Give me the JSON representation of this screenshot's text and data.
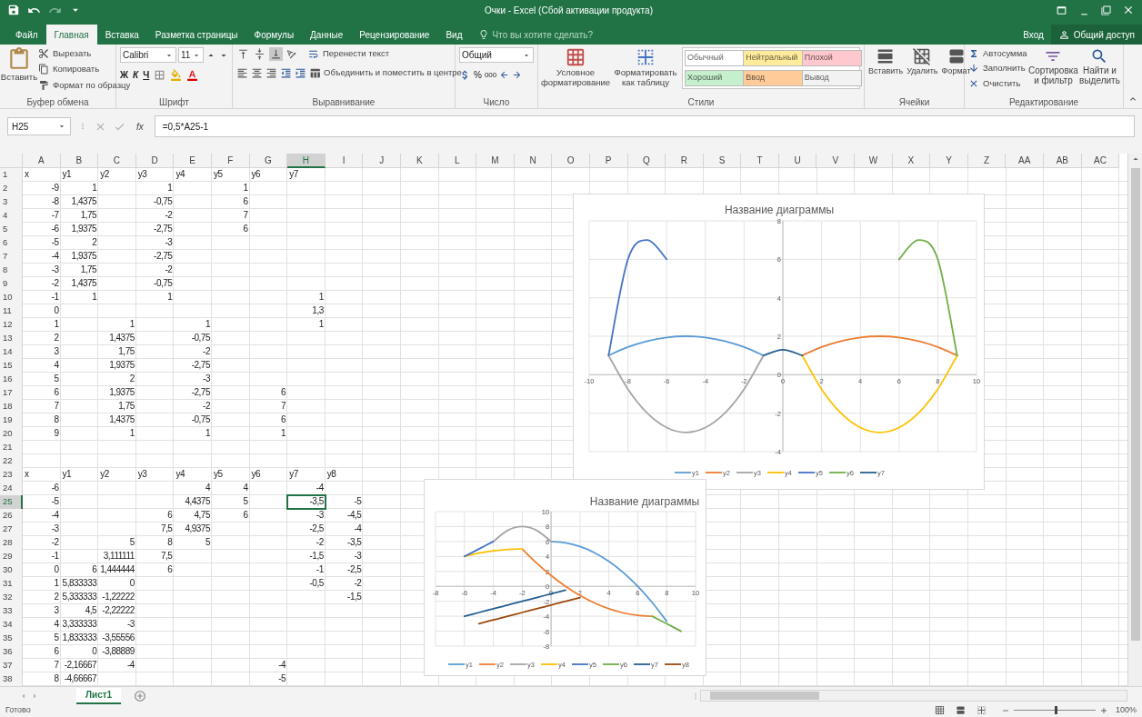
{
  "window": {
    "title": "Очки - Excel (Сбой активации продукта)"
  },
  "tabs": [
    {
      "label": "Файл",
      "selected": false
    },
    {
      "label": "Главная",
      "selected": true
    },
    {
      "label": "Вставка",
      "selected": false
    },
    {
      "label": "Разметка страницы",
      "selected": false
    },
    {
      "label": "Формулы",
      "selected": false
    },
    {
      "label": "Данные",
      "selected": false
    },
    {
      "label": "Рецензирование",
      "selected": false
    },
    {
      "label": "Вид",
      "selected": false
    }
  ],
  "tell_me": {
    "placeholder": "Что вы хотите сделать?"
  },
  "sign_in": "Вход",
  "share": "Общий доступ",
  "ribbon": {
    "clipboard": {
      "paste": "Вставить",
      "cut": "Вырезать",
      "copy": "Копировать",
      "format_painter": "Формат по образцу",
      "label": "Буфер обмена"
    },
    "font": {
      "family": "Calibri",
      "size": "11",
      "bold": "Ж",
      "italic": "К",
      "underline": "Ч",
      "label": "Шрифт"
    },
    "alignment": {
      "vertical_align": [
        {
          "selected": false
        },
        {
          "selected": false
        },
        {
          "selected": true
        }
      ],
      "wrap": "Перенести текст",
      "merge": "Объединить и поместить в центре",
      "label": "Выравнивание"
    },
    "number": {
      "format": "Общий",
      "percent": "%",
      "thousands": "000",
      "label": "Число"
    },
    "styles": {
      "conditional": "Условное форматирование",
      "format_table": "Форматировать как таблицу",
      "cell_styles": [
        {
          "label": "Обычный",
          "color": "#ffffff"
        },
        {
          "label": "Нейтральный",
          "color": "#ffeb9c"
        },
        {
          "label": "Плохой",
          "color": "#ffc7ce"
        },
        {
          "label": "Хороший",
          "color": "#c6efce"
        },
        {
          "label": "Ввод",
          "color": "#ffcc99"
        },
        {
          "label": "Вывод",
          "color": "#f2f2f2"
        }
      ],
      "label": "Стили"
    },
    "cells": {
      "buttons": [
        "Вставить",
        "Удалить",
        "Формат"
      ],
      "label": "Ячейки"
    },
    "editing": {
      "autosum": "Автосумма",
      "fill": "Заполнить",
      "clear": "Очистить",
      "sort": "Сортировка и фильтр",
      "find": "Найти и выделить",
      "label": "Редактирование"
    }
  },
  "formula_bar": {
    "name_box": "H25",
    "fx": "fx",
    "formula": "=0,5*A25-1"
  },
  "sheet": {
    "columns": [
      {
        "label": "A",
        "selected": false
      },
      {
        "label": "B",
        "selected": false
      },
      {
        "label": "C",
        "selected": false
      },
      {
        "label": "D",
        "selected": false
      },
      {
        "label": "E",
        "selected": false
      },
      {
        "label": "F",
        "selected": false
      },
      {
        "label": "G",
        "selected": false
      },
      {
        "label": "H",
        "selected": true
      },
      {
        "label": "I",
        "selected": false
      },
      {
        "label": "J",
        "selected": false
      },
      {
        "label": "K",
        "selected": false
      },
      {
        "label": "L",
        "selected": false
      },
      {
        "label": "M",
        "selected": false
      },
      {
        "label": "N",
        "selected": false
      },
      {
        "label": "O",
        "selected": false
      },
      {
        "label": "P",
        "selected": false
      },
      {
        "label": "Q",
        "selected": false
      },
      {
        "label": "R",
        "selected": false
      },
      {
        "label": "S",
        "selected": false
      },
      {
        "label": "T",
        "selected": false
      },
      {
        "label": "U",
        "selected": false
      },
      {
        "label": "V",
        "selected": false
      },
      {
        "label": "W",
        "selected": false
      },
      {
        "label": "X",
        "selected": false
      },
      {
        "label": "Y",
        "selected": false
      },
      {
        "label": "Z",
        "selected": false
      },
      {
        "label": "AA",
        "selected": false
      },
      {
        "label": "AB",
        "selected": false
      },
      {
        "label": "AC",
        "selected": false
      }
    ],
    "rows": [
      {
        "number": "1",
        "kind": "header",
        "selected": false,
        "cells": [
          "x",
          "y1",
          "y2",
          "y3",
          "y4",
          "y5",
          "y6",
          "y7"
        ]
      },
      {
        "number": "2",
        "kind": "data",
        "selected": false,
        "cells": [
          "-9",
          "1",
          null,
          "1",
          null,
          "1"
        ]
      },
      {
        "number": "3",
        "kind": "data",
        "selected": false,
        "cells": [
          "-8",
          "1,4375",
          null,
          "-0,75",
          null,
          "6"
        ]
      },
      {
        "number": "4",
        "kind": "data",
        "selected": false,
        "cells": [
          "-7",
          "1,75",
          null,
          "-2",
          null,
          "7"
        ]
      },
      {
        "number": "5",
        "kind": "data",
        "selected": false,
        "cells": [
          "-6",
          "1,9375",
          null,
          "-2,75",
          null,
          "6"
        ]
      },
      {
        "number": "6",
        "kind": "data",
        "selected": false,
        "cells": [
          "-5",
          "2",
          null,
          "-3"
        ]
      },
      {
        "number": "7",
        "kind": "data",
        "selected": false,
        "cells": [
          "-4",
          "1,9375",
          null,
          "-2,75"
        ]
      },
      {
        "number": "8",
        "kind": "data",
        "selected": false,
        "cells": [
          "-3",
          "1,75",
          null,
          "-2"
        ]
      },
      {
        "number": "9",
        "kind": "data",
        "selected": false,
        "cells": [
          "-2",
          "1,4375",
          null,
          "-0,75"
        ]
      },
      {
        "number": "10",
        "kind": "data",
        "selected": false,
        "cells": [
          "-1",
          "1",
          null,
          "1",
          null,
          null,
          null,
          "1"
        ]
      },
      {
        "number": "11",
        "kind": "data",
        "selected": false,
        "cells": [
          "0",
          null,
          null,
          null,
          null,
          null,
          null,
          "1,3"
        ]
      },
      {
        "number": "12",
        "kind": "data",
        "selected": false,
        "cells": [
          "1",
          null,
          "1",
          null,
          "1",
          null,
          null,
          "1"
        ]
      },
      {
        "number": "13",
        "kind": "data",
        "selected": false,
        "cells": [
          "2",
          null,
          "1,4375",
          null,
          "-0,75"
        ]
      },
      {
        "number": "14",
        "kind": "data",
        "selected": false,
        "cells": [
          "3",
          null,
          "1,75",
          null,
          "-2"
        ]
      },
      {
        "number": "15",
        "kind": "data",
        "selected": false,
        "cells": [
          "4",
          null,
          "1,9375",
          null,
          "-2,75"
        ]
      },
      {
        "number": "16",
        "kind": "data",
        "selected": false,
        "cells": [
          "5",
          null,
          "2",
          null,
          "-3"
        ]
      },
      {
        "number": "17",
        "kind": "data",
        "selected": false,
        "cells": [
          "6",
          null,
          "1,9375",
          null,
          "-2,75",
          null,
          "6"
        ]
      },
      {
        "number": "18",
        "kind": "data",
        "selected": false,
        "cells": [
          "7",
          null,
          "1,75",
          null,
          "-2",
          null,
          "7"
        ]
      },
      {
        "number": "19",
        "kind": "data",
        "selected": false,
        "cells": [
          "8",
          null,
          "1,4375",
          null,
          "-0,75",
          null,
          "6"
        ]
      },
      {
        "number": "20",
        "kind": "data",
        "selected": false,
        "cells": [
          "9",
          null,
          "1",
          null,
          "1",
          null,
          "1"
        ]
      },
      {
        "number": "21",
        "kind": "data",
        "selected": false,
        "cells": []
      },
      {
        "number": "22",
        "kind": "data",
        "selected": false,
        "cells": []
      },
      {
        "number": "23",
        "kind": "header",
        "selected": false,
        "cells": [
          "x",
          "y1",
          "y2",
          "y3",
          "y4",
          "y5",
          "y6",
          "y7",
          "y8"
        ]
      },
      {
        "number": "24",
        "kind": "data",
        "selected": false,
        "cells": [
          "-6",
          null,
          null,
          null,
          "4",
          "4",
          null,
          "-4"
        ]
      },
      {
        "number": "25",
        "kind": "data",
        "selected": true,
        "cells": [
          "-5",
          null,
          null,
          null,
          "4,4375",
          "5",
          null,
          "-3,5",
          "-5"
        ]
      },
      {
        "number": "26",
        "kind": "data",
        "selected": false,
        "cells": [
          "-4",
          null,
          null,
          "6",
          "4,75",
          "6",
          null,
          "-3",
          "-4,5"
        ]
      },
      {
        "number": "27",
        "kind": "data",
        "selected": false,
        "cells": [
          "-3",
          null,
          null,
          "7,5",
          "4,9375",
          null,
          null,
          "-2,5",
          "-4"
        ]
      },
      {
        "number": "28",
        "kind": "data",
        "selected": false,
        "cells": [
          "-2",
          null,
          "5",
          "8",
          "5",
          null,
          null,
          "-2",
          "-3,5"
        ]
      },
      {
        "number": "29",
        "kind": "data",
        "selected": false,
        "cells": [
          "-1",
          null,
          "3,111111",
          "7,5",
          null,
          null,
          null,
          "-1,5",
          "-3"
        ]
      },
      {
        "number": "30",
        "kind": "data",
        "selected": false,
        "cells": [
          "0",
          "6",
          "1,444444",
          "6",
          null,
          null,
          null,
          "-1",
          "-2,5"
        ]
      },
      {
        "number": "31",
        "kind": "data",
        "selected": false,
        "cells": [
          "1",
          "5,833333",
          "0",
          null,
          null,
          null,
          null,
          "-0,5",
          "-2"
        ]
      },
      {
        "number": "32",
        "kind": "data",
        "selected": false,
        "cells": [
          "2",
          "5,333333",
          "-1,22222",
          null,
          null,
          null,
          null,
          null,
          "-1,5"
        ]
      },
      {
        "number": "33",
        "kind": "data",
        "selected": false,
        "cells": [
          "3",
          "4,5",
          "-2,22222"
        ]
      },
      {
        "number": "34",
        "kind": "data",
        "selected": false,
        "cells": [
          "4",
          "3,333333",
          "-3"
        ]
      },
      {
        "number": "35",
        "kind": "data",
        "selected": false,
        "cells": [
          "5",
          "1,833333",
          "-3,55556"
        ]
      },
      {
        "number": "36",
        "kind": "data",
        "selected": false,
        "cells": [
          "6",
          "0",
          "-3,88889"
        ]
      },
      {
        "number": "37",
        "kind": "data",
        "selected": false,
        "cells": [
          "7",
          "-2,16667",
          "-4",
          null,
          null,
          null,
          "-4"
        ]
      },
      {
        "number": "38",
        "kind": "data",
        "selected": false,
        "cells": [
          "8",
          "-4,66667",
          null,
          null,
          null,
          null,
          "-5"
        ]
      }
    ]
  },
  "charts": [
    {
      "chart_data": {
        "type": "line",
        "title": "Название диаграммы",
        "grid": true,
        "legend": "bottom",
        "x": [
          -9,
          -8,
          -7,
          -6,
          -5,
          -4,
          -3,
          -2,
          -1,
          0,
          1,
          2,
          3,
          4,
          5,
          6,
          7,
          8,
          9
        ],
        "xlim": [
          -10,
          10
        ],
        "ylim": [
          -4,
          8
        ],
        "xticks": [
          -10,
          -8,
          -6,
          -4,
          -2,
          0,
          2,
          4,
          6,
          8,
          10
        ],
        "yticks": [
          -4,
          -2,
          0,
          2,
          4,
          6,
          8
        ],
        "series": [
          {
            "name": "y1",
            "color": "#5b9bd5",
            "values": [
              1,
              1.4375,
              1.75,
              1.9375,
              2,
              1.9375,
              1.75,
              1.4375,
              1,
              null,
              null,
              null,
              null,
              null,
              null,
              null,
              null,
              null,
              null
            ]
          },
          {
            "name": "y2",
            "color": "#ed7d31",
            "values": [
              null,
              null,
              null,
              null,
              null,
              null,
              null,
              null,
              null,
              null,
              1,
              1.4375,
              1.75,
              1.9375,
              2,
              1.9375,
              1.75,
              1.4375,
              1
            ]
          },
          {
            "name": "y3",
            "color": "#a5a5a5",
            "values": [
              1,
              -0.75,
              -2,
              -2.75,
              -3,
              -2.75,
              -2,
              -0.75,
              1,
              null,
              null,
              null,
              null,
              null,
              null,
              null,
              null,
              null,
              null
            ]
          },
          {
            "name": "y4",
            "color": "#ffc000",
            "values": [
              null,
              null,
              null,
              null,
              null,
              null,
              null,
              null,
              null,
              null,
              1,
              -0.75,
              -2,
              -2.75,
              -3,
              -2.75,
              -2,
              -0.75,
              1
            ]
          },
          {
            "name": "y5",
            "color": "#4472c4",
            "values": [
              1,
              6,
              7,
              6,
              null,
              null,
              null,
              null,
              null,
              null,
              null,
              null,
              null,
              null,
              null,
              null,
              null,
              null,
              null
            ]
          },
          {
            "name": "y6",
            "color": "#70ad47",
            "values": [
              null,
              null,
              null,
              null,
              null,
              null,
              null,
              null,
              null,
              null,
              null,
              null,
              null,
              null,
              null,
              6,
              7,
              6,
              1
            ]
          },
          {
            "name": "y7",
            "color": "#255e91",
            "values": [
              null,
              null,
              null,
              null,
              null,
              null,
              null,
              null,
              1,
              1.3,
              1,
              null,
              null,
              null,
              null,
              null,
              null,
              null,
              null
            ]
          }
        ]
      }
    },
    {
      "chart_data": {
        "type": "line",
        "title": "Название диаграммы",
        "grid": true,
        "legend": "bottom",
        "x": [
          -6,
          -5,
          -4,
          -3,
          -2,
          -1,
          0,
          1,
          2,
          3,
          4,
          5,
          6,
          7,
          8,
          9
        ],
        "xlim": [
          -8,
          10
        ],
        "ylim": [
          -8,
          10
        ],
        "xticks": [
          -8,
          -6,
          -4,
          -2,
          0,
          2,
          4,
          6,
          8,
          10
        ],
        "yticks": [
          -8,
          -6,
          -4,
          -2,
          0,
          2,
          4,
          6,
          8,
          10
        ],
        "series": [
          {
            "name": "y1",
            "color": "#5b9bd5",
            "values": [
              null,
              null,
              null,
              null,
              null,
              null,
              6,
              5.833333,
              5.333333,
              4.5,
              3.333333,
              1.833333,
              0,
              -2.16667,
              -4.66667,
              null
            ]
          },
          {
            "name": "y2",
            "color": "#ed7d31",
            "values": [
              null,
              null,
              null,
              null,
              5,
              3.111111,
              1.444444,
              0,
              -1.22222,
              -2.22222,
              -3,
              -3.55556,
              -3.88889,
              -4,
              null,
              null
            ]
          },
          {
            "name": "y3",
            "color": "#a5a5a5",
            "values": [
              null,
              null,
              6,
              7.5,
              8,
              7.5,
              6,
              null,
              null,
              null,
              null,
              null,
              null,
              null,
              null,
              null
            ]
          },
          {
            "name": "y4",
            "color": "#ffc000",
            "values": [
              4,
              4.4375,
              4.75,
              4.9375,
              5,
              null,
              null,
              null,
              null,
              null,
              null,
              null,
              null,
              null,
              null,
              null
            ]
          },
          {
            "name": "y5",
            "color": "#4472c4",
            "values": [
              4,
              5,
              6,
              null,
              null,
              null,
              null,
              null,
              null,
              null,
              null,
              null,
              null,
              null,
              null,
              null
            ]
          },
          {
            "name": "y6",
            "color": "#70ad47",
            "values": [
              null,
              null,
              null,
              null,
              null,
              null,
              null,
              null,
              null,
              null,
              null,
              null,
              null,
              -4,
              -5,
              -6
            ]
          },
          {
            "name": "y7",
            "color": "#255e91",
            "values": [
              -4,
              -3.5,
              -3,
              -2.5,
              -2,
              -1.5,
              -1,
              -0.5,
              null,
              null,
              null,
              null,
              null,
              null,
              null,
              null
            ]
          },
          {
            "name": "y8",
            "color": "#9e480e",
            "values": [
              null,
              -5,
              -4.5,
              -4,
              -3.5,
              -3,
              -2.5,
              -2,
              -1.5,
              null,
              null,
              null,
              null,
              null,
              null,
              null
            ]
          }
        ]
      }
    }
  ],
  "sheet_tabs": [
    {
      "label": "Лист1",
      "selected": true
    }
  ],
  "status_bar": {
    "status": "Готово",
    "zoom": {
      "level": 0.5,
      "reading": "100%"
    }
  }
}
